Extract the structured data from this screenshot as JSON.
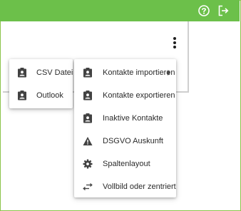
{
  "colors": {
    "accent": "#6cc04a",
    "icon": "#424242",
    "border": "#8bc34a"
  },
  "topbar": {
    "help_icon": "help-circle-icon",
    "logout_icon": "logout-icon"
  },
  "kebab_icon": "more-vertical-icon",
  "submenu": {
    "items": [
      {
        "label": "CSV Datei",
        "icon": "contact-badge-icon"
      },
      {
        "label": "Outlook",
        "icon": "contact-badge-icon"
      }
    ]
  },
  "menu": {
    "items": [
      {
        "label": "Kontakte importieren",
        "icon": "contact-badge-icon",
        "has_submenu": true
      },
      {
        "label": "Kontakte exportieren",
        "icon": "contact-badge-icon"
      },
      {
        "label": "Inaktive Kontakte",
        "icon": "contact-badge-icon"
      },
      {
        "label": "DSGVO Auskunft",
        "icon": "warning-icon"
      },
      {
        "label": "Spaltenlayout",
        "icon": "gear-icon"
      },
      {
        "label": "Vollbild oder zentriert",
        "icon": "swap-arrows-icon"
      }
    ]
  }
}
